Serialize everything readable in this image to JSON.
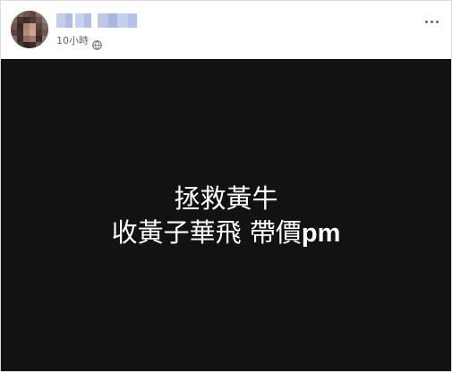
{
  "post": {
    "timestamp": "10小時",
    "image_text": {
      "line1": "拯救黃牛",
      "line2_main": "收黃子華飛 帶價",
      "line2_suffix": "pm"
    }
  },
  "icons": {
    "avatar": "profile-photo-pixelated",
    "privacy": "globe-icon",
    "more": "more-horizontal-icon"
  },
  "colors": {
    "card_border": "#d9dce1",
    "meta_text": "#606770",
    "image_background": "#121212",
    "image_text": "#ffffff",
    "blurred_name": "#b7c3e6"
  }
}
